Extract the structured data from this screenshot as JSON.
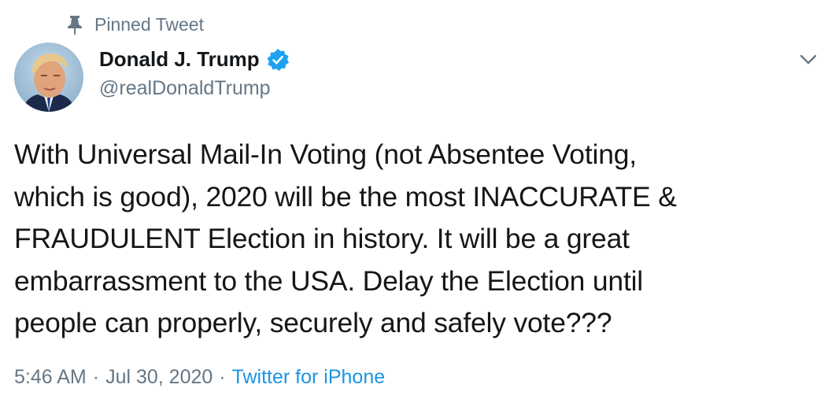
{
  "pinned": {
    "label": "Pinned Tweet",
    "icon": "pin-icon"
  },
  "author": {
    "name": "Donald J. Trump",
    "handle": "@realDonaldTrump",
    "verified": true,
    "verified_color": "#1da1f2"
  },
  "tweet": {
    "lines": [
      "With Universal Mail-In Voting (not Absentee Voting,",
      "which is good), 2020 will be the most INACCURATE &",
      "FRAUDULENT Election in history. It will be a great",
      "embarrassment to the USA. Delay the Election until",
      "people can properly, securely and safely vote???"
    ]
  },
  "meta": {
    "time": "5:46 AM",
    "separator": "·",
    "date": "Jul 30, 2020",
    "source": "Twitter for iPhone"
  },
  "colors": {
    "text": "#14171a",
    "secondary": "#657786",
    "link": "#1b95e0"
  }
}
